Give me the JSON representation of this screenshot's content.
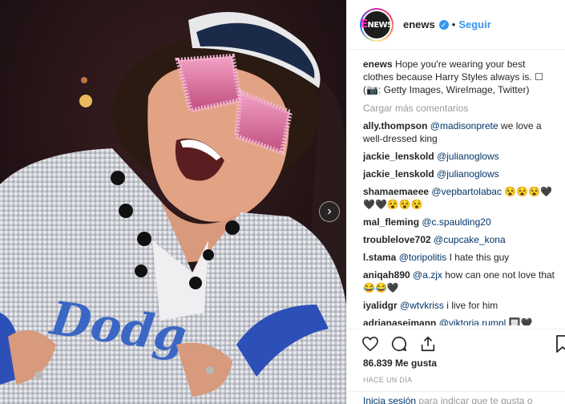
{
  "header": {
    "avatar_text": "E",
    "avatar_text2": "NEWS",
    "username": "enews",
    "verified_symbol": "✓",
    "separator": "•",
    "follow_label": "Seguir"
  },
  "caption": {
    "user": "enews",
    "text": "Hope you're wearing your best clothes because Harry Styles always is. ",
    "box": "☐",
    "credit": "(📷: Getty Images, WireImage, Twitter)"
  },
  "load_more": "Cargar más comentarios",
  "comments": [
    {
      "user": "ally.thompson",
      "mention": "@madisonprete",
      "text": "we love a well-dressed king"
    },
    {
      "user": "jackie_lenskold",
      "mention": "@julianoglows",
      "text": ""
    },
    {
      "user": "jackie_lenskold",
      "mention": "@julianoglows",
      "text": ""
    },
    {
      "user": "shamaemaeee",
      "mention": "@vepbartolabac",
      "text": "😵😵😵🖤🖤🖤😵😵😵"
    },
    {
      "user": "mal_fleming",
      "mention": "@c.spaulding20",
      "text": ""
    },
    {
      "user": "troublelove702",
      "mention": "@cupcake_kona",
      "text": ""
    },
    {
      "user": "l.stama",
      "mention": "@toripolitis",
      "text": "I hate this guy"
    },
    {
      "user": "aniqah890",
      "mention": "@a.zjx",
      "text": "how can one not love that 😂😂🖤"
    },
    {
      "user": "iyalidgr",
      "mention": "@wtvkriss",
      "text": "i live for him"
    },
    {
      "user": "adrianaseimann",
      "mention": "@viktoria.rumpl",
      "text": "🔲🖤"
    }
  ],
  "likes": "86.839 Me gusta",
  "timestamp": "HACE UN DÍA",
  "login": {
    "link": "Inicia sesión",
    "text": "para indicar que te gusta o"
  },
  "carousel_next": "›",
  "colors": {
    "accent": "#3897f0",
    "mention": "#003569",
    "muted": "#999999"
  }
}
